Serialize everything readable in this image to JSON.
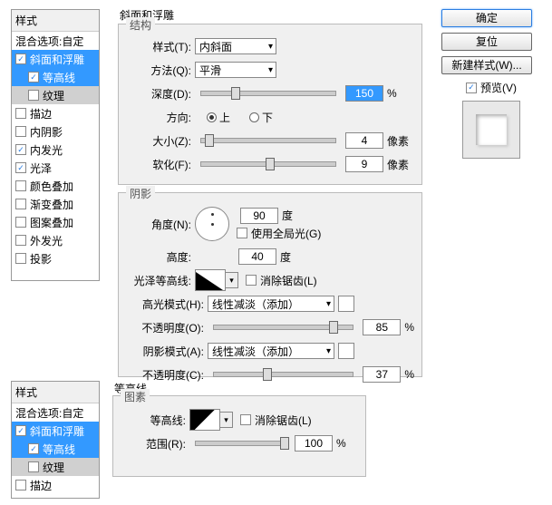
{
  "styles_header": "样式",
  "blend_opts": "混合选项:自定",
  "styles1": [
    {
      "label": "斜面和浮雕",
      "on": true,
      "sel": true
    },
    {
      "label": "等高线",
      "on": true,
      "sub": true,
      "sel": true
    },
    {
      "label": "纹理",
      "on": false,
      "sub": true,
      "selgray": true
    },
    {
      "label": "描边",
      "on": false
    },
    {
      "label": "内阴影",
      "on": false
    },
    {
      "label": "内发光",
      "on": true
    },
    {
      "label": "光泽",
      "on": true
    },
    {
      "label": "颜色叠加",
      "on": false
    },
    {
      "label": "渐变叠加",
      "on": false
    },
    {
      "label": "图案叠加",
      "on": false
    },
    {
      "label": "外发光",
      "on": false
    },
    {
      "label": "投影",
      "on": false
    }
  ],
  "styles2": [
    {
      "label": "斜面和浮雕",
      "on": true,
      "sel": true
    },
    {
      "label": "等高线",
      "on": true,
      "sub": true,
      "sel": true
    },
    {
      "label": "纹理",
      "on": false,
      "sub": true,
      "selgray": true
    },
    {
      "label": "描边",
      "on": false
    }
  ],
  "main_title": "斜面和浮雕",
  "struct": {
    "title": "结构",
    "style_l": "样式(T):",
    "style_v": "内斜面",
    "method_l": "方法(Q):",
    "method_v": "平滑",
    "depth_l": "深度(D):",
    "depth_v": "150",
    "pct": "%",
    "dir_l": "方向:",
    "up": "上",
    "down": "下",
    "size_l": "大小(Z):",
    "size_v": "4",
    "px": "像素",
    "soft_l": "软化(F):",
    "soft_v": "9"
  },
  "shadow": {
    "title": "阴影",
    "angle_l": "角度(N):",
    "angle_v": "90",
    "deg": "度",
    "global": "使用全局光(G)",
    "alt_l": "高度:",
    "alt_v": "40",
    "gloss_l": "光泽等高线:",
    "anti": "消除锯齿(L)",
    "hi_mode_l": "高光模式(H):",
    "hi_mode_v": "线性减淡（添加）",
    "opac_l": "不透明度(O):",
    "hi_op": "85",
    "sh_mode_l": "阴影模式(A):",
    "sh_mode_v": "线性减淡（添加）",
    "opac2_l": "不透明度(C):",
    "sh_op": "37",
    "pct": "%"
  },
  "contour": {
    "title": "等高线",
    "elem": "图素",
    "contour_l": "等高线:",
    "anti": "消除锯齿(L)",
    "range_l": "范围(R):",
    "range_v": "100",
    "pct": "%"
  },
  "buttons": {
    "ok": "确定",
    "reset": "复位",
    "newstyle": "新建样式(W)...",
    "preview": "预览(V)"
  }
}
